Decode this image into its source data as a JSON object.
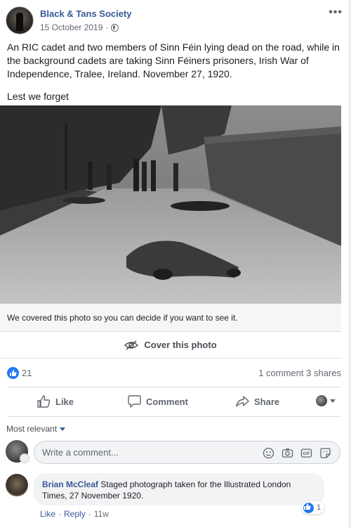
{
  "post": {
    "page_name": "Black & Tans Society",
    "date": "15 October 2019",
    "date_separator": "·",
    "body": "An RIC cadet and two members of Sinn Féin lying dead on the road, while in the background cadets are taking Sinn Féiners prisoners, Irish War of Independence, Tralee, Ireland. November 27, 1920.",
    "tagline": "Lest we forget",
    "more_icon": "•••"
  },
  "sensitive": {
    "notice": "We covered this photo so you can decide if you want to see it.",
    "cover_label": "Cover this photo"
  },
  "stats": {
    "reaction_count": "21",
    "comments": "1 comment",
    "shares": "3 shares"
  },
  "actions": {
    "like": "Like",
    "comment": "Comment",
    "share": "Share"
  },
  "comments": {
    "sort_label": "Most relevant",
    "input_placeholder": "Write a comment...",
    "items": [
      {
        "author": "Brian McCleaf",
        "text": "Staged photograph taken for the Illustrated London Times, 27 November 1920.",
        "reaction_count": "1",
        "like_label": "Like",
        "reply_label": "Reply",
        "age": "11w"
      }
    ]
  },
  "colors": {
    "brand_blue": "#385898",
    "like_blue": "#2078f4",
    "muted": "#616770"
  }
}
